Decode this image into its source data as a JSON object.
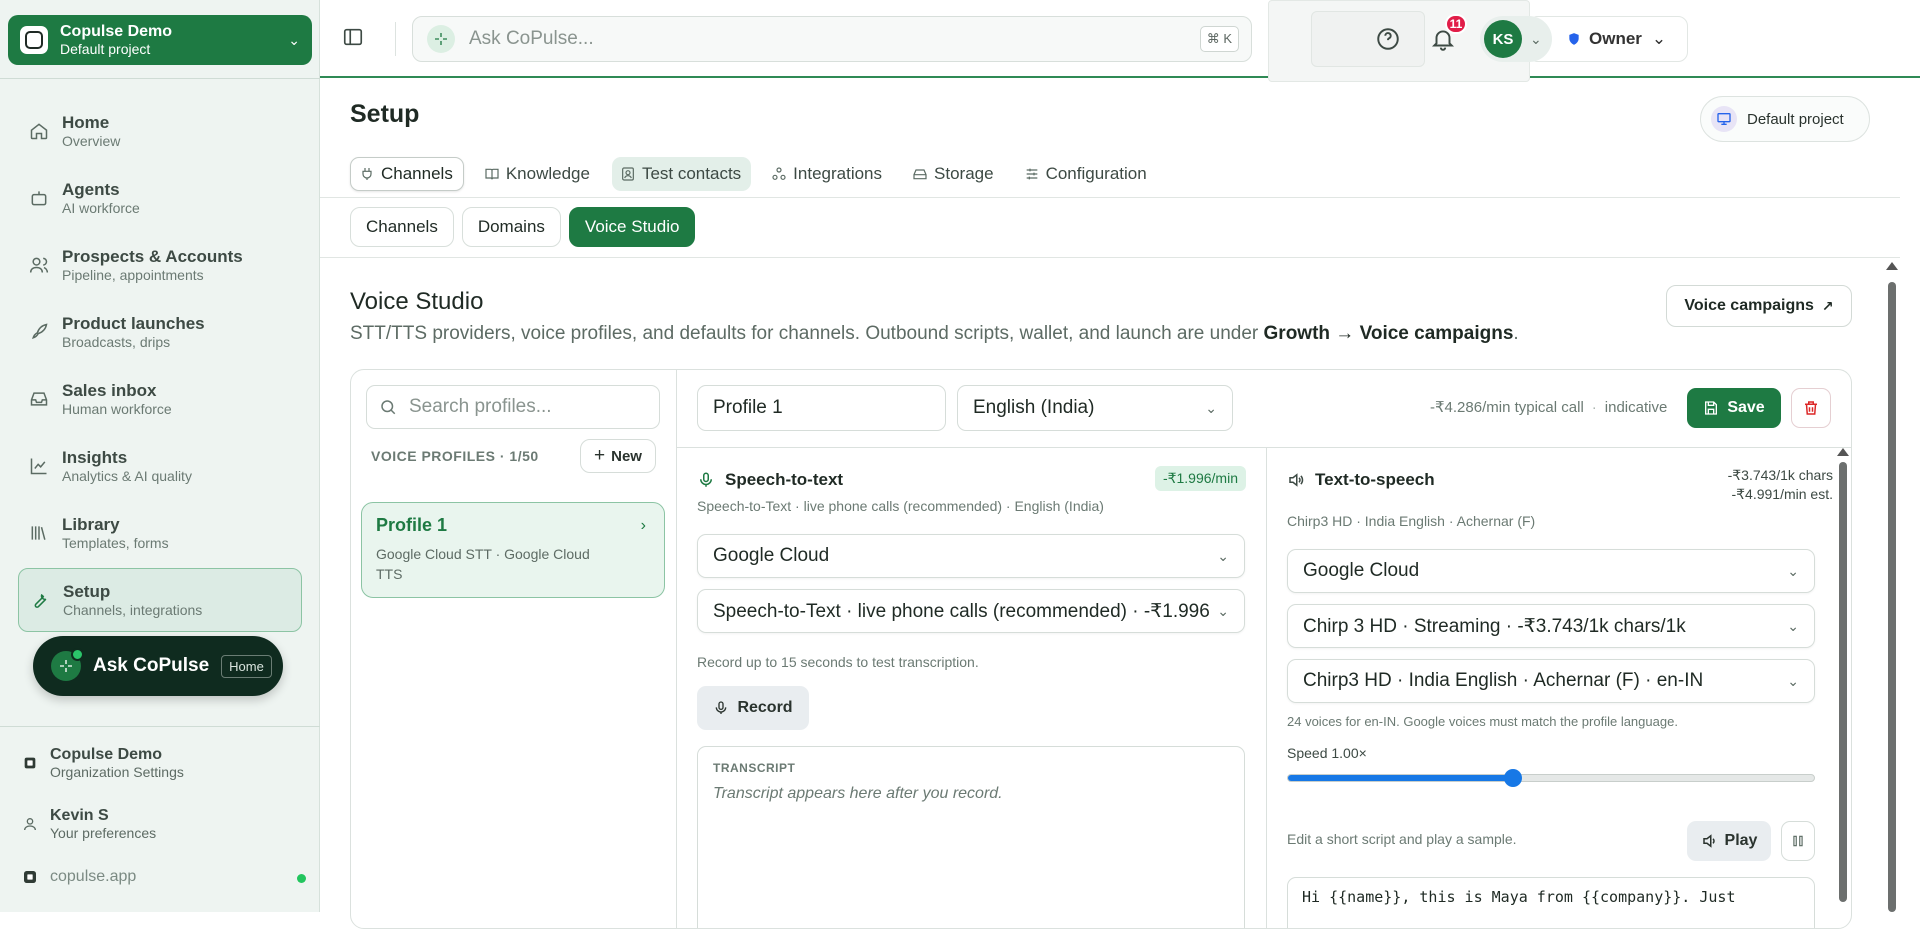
{
  "sidebar": {
    "workspace": {
      "title": "Copulse Demo",
      "subtitle": "Default project"
    },
    "nav": [
      {
        "title": "Home",
        "subtitle": "Overview",
        "icon": "home-icon"
      },
      {
        "title": "Agents",
        "subtitle": "AI workforce",
        "icon": "robot-icon"
      },
      {
        "title": "Prospects & Accounts",
        "subtitle": "Pipeline, appointments",
        "icon": "users-icon"
      },
      {
        "title": "Product launches",
        "subtitle": "Broadcasts, drips",
        "icon": "rocket-icon"
      },
      {
        "title": "Sales inbox",
        "subtitle": "Human workforce",
        "icon": "inbox-icon"
      },
      {
        "title": "Insights",
        "subtitle": "Analytics & AI quality",
        "icon": "chart-icon"
      },
      {
        "title": "Library",
        "subtitle": "Templates, forms",
        "icon": "library-icon"
      },
      {
        "title": "Setup",
        "subtitle": "Channels, integrations",
        "icon": "wrench-icon",
        "active": true
      }
    ],
    "ask": {
      "label": "Ask CoPulse",
      "badge": "Home"
    },
    "org": {
      "title": "Copulse Demo",
      "subtitle": "Organization Settings"
    },
    "user": {
      "title": "Kevin S",
      "subtitle": "Your preferences"
    },
    "footer_url": "copulse.app"
  },
  "topbar": {
    "ask_placeholder": "Ask CoPulse...",
    "shortcut": "⌘ K",
    "role": "Owner",
    "notifications": "11",
    "avatar_initials": "KS"
  },
  "page": {
    "title": "Setup",
    "project_button": "Default project",
    "tabs": [
      "Channels",
      "Knowledge",
      "Test contacts",
      "Integrations",
      "Storage",
      "Configuration"
    ],
    "subtabs": [
      "Channels",
      "Domains",
      "Voice Studio"
    ]
  },
  "voice_studio": {
    "title": "Voice Studio",
    "desc_prefix": "STT/TTS providers, voice profiles, and defaults for channels. Outbound scripts, wallet, and launch are under ",
    "desc_link": "Growth → Voice campaigns",
    "desc_suffix": ".",
    "campaigns_button": "Voice campaigns",
    "search_placeholder": "Search profiles...",
    "profiles_label": "VOICE PROFILES · 1/50",
    "new_button": "New",
    "profile": {
      "name": "Profile 1",
      "providers": "Google Cloud STT · Google Cloud TTS"
    },
    "profile_name_value": "Profile 1",
    "language": "English (India)",
    "cost_typical": "-₹4.286/min typical call",
    "cost_note": "indicative",
    "save_label": "Save",
    "stt": {
      "title": "Speech-to-text",
      "rate": "-₹1.996/min",
      "subtitle": "Speech-to-Text · live phone calls (recommended) · English (India)",
      "provider": "Google Cloud",
      "model": "Speech-to-Text · live phone calls (recommended) · -₹1.996",
      "record_hint": "Record up to 15 seconds to test transcription.",
      "record_label": "Record",
      "transcript_label": "TRANSCRIPT",
      "transcript_placeholder": "Transcript appears here after you record."
    },
    "tts": {
      "title": "Text-to-speech",
      "rate_chars": "-₹3.743/1k chars",
      "rate_min": "-₹4.991/min est.",
      "subtitle": "Chirp3 HD · India English · Achernar (F)",
      "provider": "Google Cloud",
      "model": "Chirp 3 HD · Streaming · -₹3.743/1k chars/1k",
      "voice": "Chirp3 HD · India English · Achernar (F) · en-IN",
      "voices_hint": "24 voices for en-IN. Google voices must match the profile language.",
      "speed_label": "Speed 1.00×",
      "speed_value": 1.0,
      "speed_min": 0.25,
      "speed_max": 2.0,
      "sample_hint": "Edit a short script and play a sample.",
      "play_label": "Play",
      "script": "Hi {{name}}, this is Maya from {{company}}. Just"
    }
  },
  "colors": {
    "accent": "#1e7a43",
    "slider": "#1778e6",
    "badge": "#e11d48"
  }
}
